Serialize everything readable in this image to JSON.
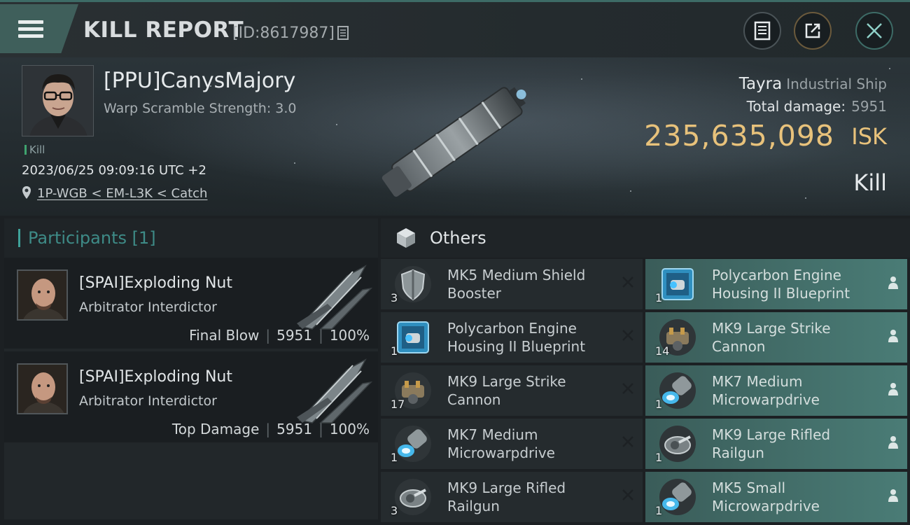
{
  "header": {
    "title": "KILL REPORT",
    "report_id": "[ID:8617987]"
  },
  "victim": {
    "name": "[PPU]CanysMajory",
    "warp_scramble": "Warp Scramble Strength: 3.0",
    "tag": "Kill",
    "time": "2023/06/25 09:09:16 UTC +2",
    "location": "1P-WGB < EM-L3K < Catch",
    "ship_name": "Tayra",
    "ship_class": "Industrial Ship",
    "total_damage_label": "Total damage:",
    "total_damage": "5951",
    "isk_value": "235,635,098",
    "isk_label": "ISK",
    "result": "Kill"
  },
  "participants": {
    "header": "Participants [1]",
    "list": [
      {
        "name": "[SPAI]Exploding Nut",
        "ship": "Arbitrator Interdictor",
        "role": "Final Blow",
        "damage": "5951",
        "percent": "100%"
      },
      {
        "name": "[SPAI]Exploding Nut",
        "ship": "Arbitrator Interdictor",
        "role": "Top Damage",
        "damage": "5951",
        "percent": "100%"
      }
    ]
  },
  "others": {
    "header": "Others",
    "destroyed": [
      {
        "name": "MK5 Medium Shield Booster",
        "qty": "3",
        "icon": "shield-booster-icon"
      },
      {
        "name": "Polycarbon Engine Housing II Blueprint",
        "qty": "1",
        "icon": "blueprint-icon"
      },
      {
        "name": "MK9 Large Strike Cannon",
        "qty": "17",
        "icon": "cannon-icon"
      },
      {
        "name": "MK7 Medium Microwarpdrive",
        "qty": "1",
        "icon": "microwarpdrive-icon"
      },
      {
        "name": "MK9 Large Rifled Railgun",
        "qty": "3",
        "icon": "railgun-icon"
      }
    ],
    "dropped": [
      {
        "name": "Polycarbon Engine Housing II Blueprint",
        "qty": "1",
        "icon": "blueprint-icon"
      },
      {
        "name": "MK9 Large Strike Cannon",
        "qty": "14",
        "icon": "cannon-icon"
      },
      {
        "name": "MK7 Medium Microwarpdrive",
        "qty": "1",
        "icon": "microwarpdrive-icon"
      },
      {
        "name": "MK9 Large Rifled Railgun",
        "qty": "1",
        "icon": "railgun-icon"
      },
      {
        "name": "MK5 Small Microwarpdrive",
        "qty": "1",
        "icon": "microwarpdrive-icon"
      }
    ]
  },
  "colors": {
    "accent_teal": "#3e8b87",
    "isk_gold": "#e8c27b",
    "dropped_bg": "#4a7c76"
  }
}
